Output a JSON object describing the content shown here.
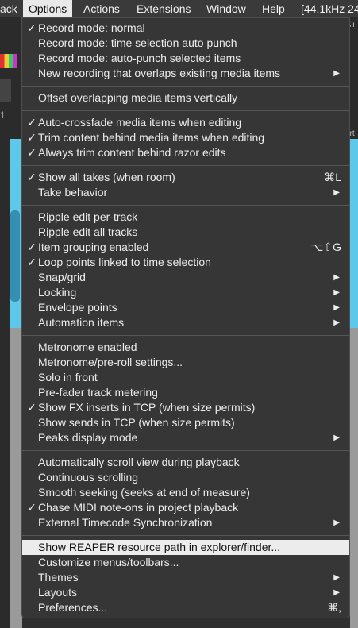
{
  "menubar": [
    "ack",
    "Options",
    "Actions",
    "Extensions",
    "Window",
    "Help",
    "[44.1kHz 24"
  ],
  "background": {
    "top_right": "5+",
    "left_label": "1",
    "right_label": "ort",
    "angle": "r"
  },
  "menu": [
    {
      "label": "Record mode: normal",
      "checked": true
    },
    {
      "label": "Record mode: time selection auto punch"
    },
    {
      "label": "Record mode: auto-punch selected items"
    },
    {
      "label": "New recording that overlaps existing media items",
      "submenu": true
    },
    {
      "sep": true
    },
    {
      "label": "Offset overlapping media items vertically"
    },
    {
      "sep": true
    },
    {
      "label": "Auto-crossfade media items when editing",
      "checked": true
    },
    {
      "label": "Trim content behind media items when editing",
      "checked": true
    },
    {
      "label": "Always trim content behind razor edits",
      "checked": true
    },
    {
      "sep": true
    },
    {
      "label": "Show all takes (when room)",
      "checked": true,
      "shortcut": "⌘L"
    },
    {
      "label": "Take behavior",
      "submenu": true
    },
    {
      "sep": true
    },
    {
      "label": "Ripple edit per-track"
    },
    {
      "label": "Ripple edit all tracks"
    },
    {
      "label": "Item grouping enabled",
      "checked": true,
      "shortcut": "⌥⇧G"
    },
    {
      "label": "Loop points linked to time selection",
      "checked": true
    },
    {
      "label": "Snap/grid",
      "submenu": true
    },
    {
      "label": "Locking",
      "submenu": true
    },
    {
      "label": "Envelope points",
      "submenu": true
    },
    {
      "label": "Automation items",
      "submenu": true
    },
    {
      "sep": true
    },
    {
      "label": "Metronome enabled"
    },
    {
      "label": "Metronome/pre-roll settings..."
    },
    {
      "label": "Solo in front"
    },
    {
      "label": "Pre-fader track metering"
    },
    {
      "label": "Show FX inserts in TCP (when size permits)",
      "checked": true
    },
    {
      "label": "Show sends in TCP (when size permits)"
    },
    {
      "label": "Peaks display mode",
      "submenu": true
    },
    {
      "sep": true
    },
    {
      "label": "Automatically scroll view during playback"
    },
    {
      "label": "Continuous scrolling"
    },
    {
      "label": "Smooth seeking (seeks at end of measure)"
    },
    {
      "label": "Chase MIDI note-ons in project playback",
      "checked": true
    },
    {
      "label": "External Timecode Synchronization",
      "submenu": true
    },
    {
      "sep": true
    },
    {
      "label": "Show REAPER resource path in explorer/finder...",
      "highlighted": true
    },
    {
      "label": "Customize menus/toolbars..."
    },
    {
      "label": "Themes",
      "submenu": true
    },
    {
      "label": "Layouts",
      "submenu": true
    },
    {
      "label": "Preferences...",
      "shortcut": "⌘,"
    }
  ],
  "icons": {
    "check": "✓",
    "submenu": "▶"
  }
}
